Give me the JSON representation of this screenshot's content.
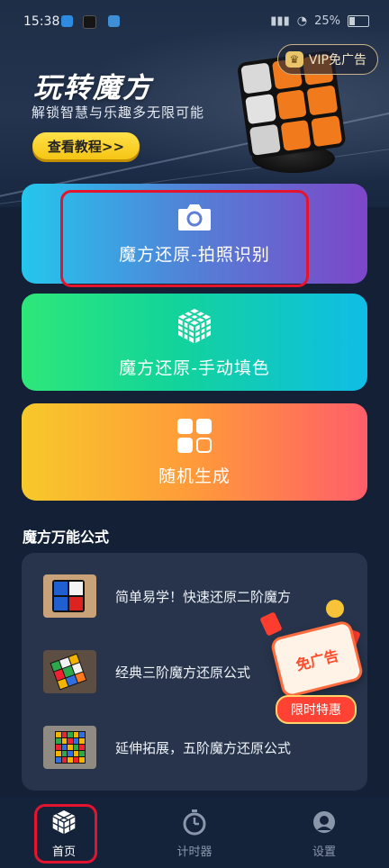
{
  "status_bar": {
    "time": "15:38",
    "battery": "25%"
  },
  "vip_button": {
    "label": "VIP免广告"
  },
  "hero": {
    "title": "玩转魔方",
    "subtitle": "解锁智慧与乐趣多无限可能",
    "tutorial_button": "查看教程>>"
  },
  "actions": [
    {
      "label": "魔方还原-拍照识别",
      "icon": "camera-icon"
    },
    {
      "label": "魔方还原-手动填色",
      "icon": "cube-icon"
    },
    {
      "label": "随机生成",
      "icon": "grid-icon"
    }
  ],
  "formulas": {
    "title": "魔方万能公式",
    "items": [
      {
        "label": "简单易学！快速还原二阶魔方"
      },
      {
        "label": "经典三阶魔方还原公式"
      },
      {
        "label": "延伸拓展，五阶魔方还原公式"
      }
    ]
  },
  "promo": {
    "badge": "免广告",
    "tag": "限时特惠"
  },
  "tabs": [
    {
      "label": "首页",
      "icon": "cube-icon",
      "active": true
    },
    {
      "label": "计时器",
      "icon": "stopwatch-icon",
      "active": false
    },
    {
      "label": "设置",
      "icon": "settings-icon",
      "active": false
    }
  ],
  "colors": {
    "highlight": "#e5142e",
    "tab_active": "#ffffff",
    "tab_inactive": "#8a96aa"
  }
}
